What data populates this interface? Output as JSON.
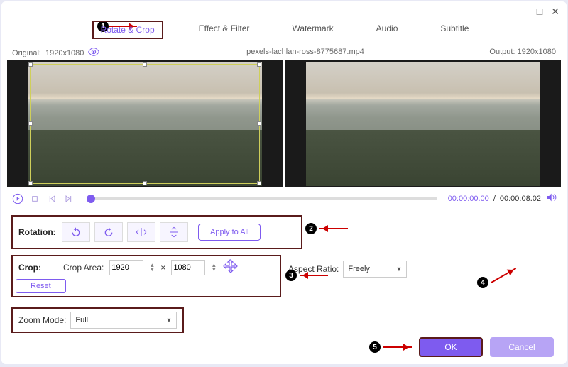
{
  "window": {
    "minimize": "□",
    "close": "✕"
  },
  "tabs": {
    "rotate_crop": "Rotate & Crop",
    "effect_filter": "Effect & Filter",
    "watermark": "Watermark",
    "audio": "Audio",
    "subtitle": "Subtitle"
  },
  "info": {
    "original_label": "Original:",
    "original_value": "1920x1080",
    "filename": "pexels-lachlan-ross-8775687.mp4",
    "output_label": "Output:",
    "output_value": "1920x1080"
  },
  "player": {
    "current_time": "00:00:00.00",
    "sep": "/",
    "duration": "00:00:08.02"
  },
  "rotation": {
    "label": "Rotation:",
    "apply_all": "Apply to All"
  },
  "crop": {
    "label": "Crop:",
    "area_label": "Crop Area:",
    "width": "1920",
    "times": "×",
    "height": "1080",
    "reset": "Reset",
    "aspect_label": "Aspect Ratio:",
    "aspect_value": "Freely",
    "zoom_label": "Zoom Mode:",
    "zoom_value": "Full"
  },
  "footer": {
    "ok": "OK",
    "cancel": "Cancel"
  },
  "annotations": {
    "a1": "1",
    "a2": "2",
    "a3": "3",
    "a4": "4",
    "a5": "5"
  }
}
